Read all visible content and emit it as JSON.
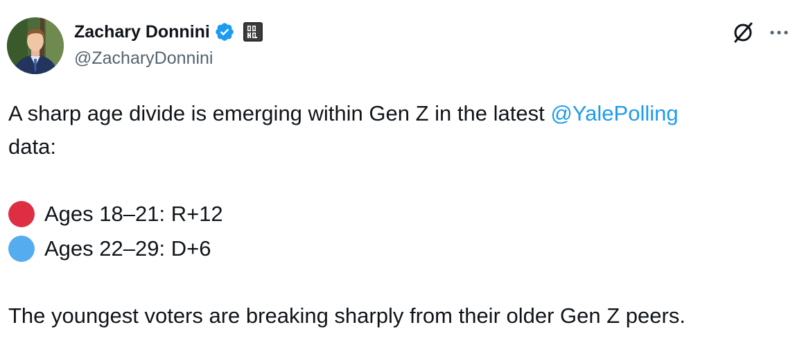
{
  "author": {
    "display_name": "Zachary Donnini",
    "handle": "@ZacharyDonnini",
    "verified": true,
    "affiliation_badge_icon": "ddhq-badge-icon"
  },
  "actions": {
    "grok_icon": "grok-icon",
    "more_icon": "more-options-icon",
    "more_label": "···"
  },
  "tweet": {
    "line1_prefix": "A sharp age divide is emerging within Gen Z in the latest ",
    "mention": "@YalePolling",
    "line2": "data:",
    "items": [
      {
        "color": "#dd2e44",
        "text": "Ages 18–21: R+12"
      },
      {
        "color": "#55acee",
        "text": "Ages 22–29: D+6"
      }
    ],
    "closing": "The youngest voters are breaking sharply from their older Gen Z peers."
  },
  "colors": {
    "verified_blue": "#1d9bf0",
    "mention_blue": "#1d9bf0",
    "secondary_text": "#536471"
  }
}
